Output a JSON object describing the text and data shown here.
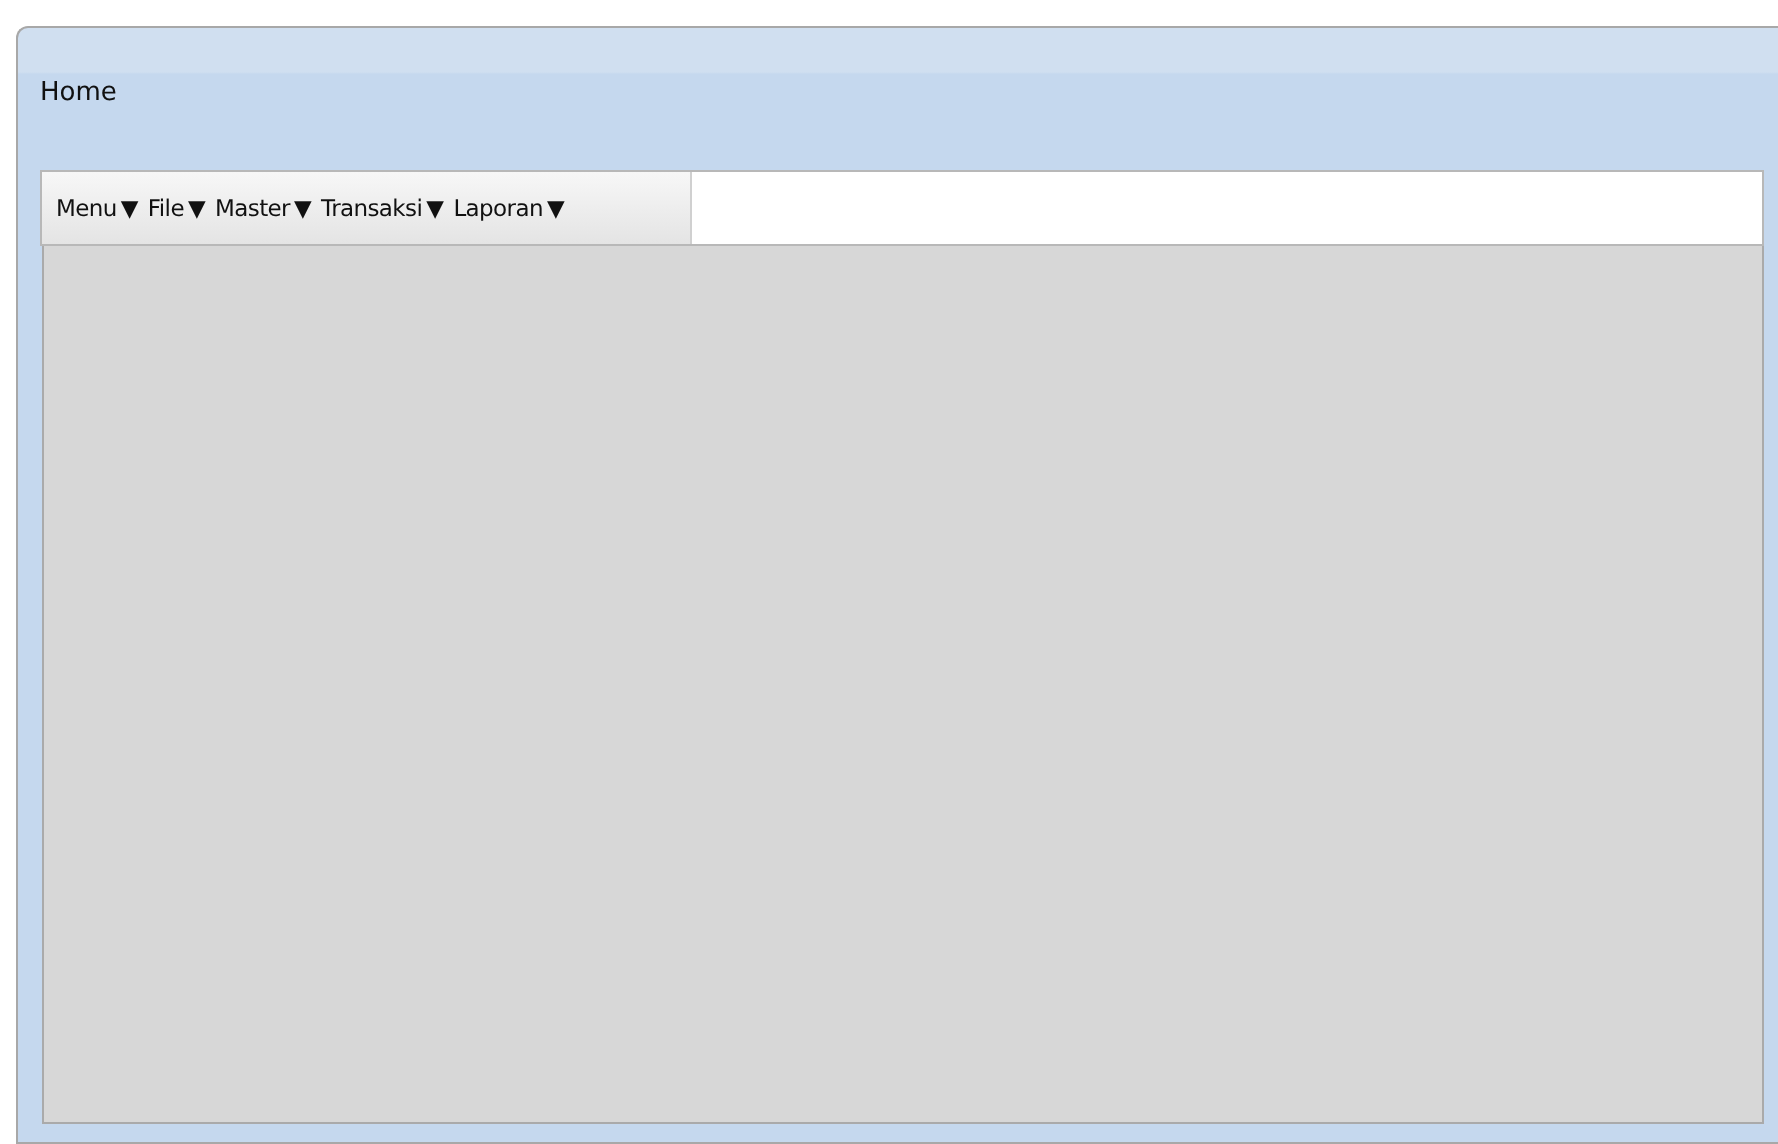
{
  "window": {
    "title": "Home"
  },
  "menu_bar": {
    "items": [
      {
        "label": "Menu",
        "arrow": "▼"
      },
      {
        "label": "File",
        "arrow": "▼"
      },
      {
        "label": "Master",
        "arrow": "▼"
      },
      {
        "label": "Transaksi",
        "arrow": "▼"
      },
      {
        "label": "Laporan",
        "arrow": "▼"
      }
    ]
  }
}
